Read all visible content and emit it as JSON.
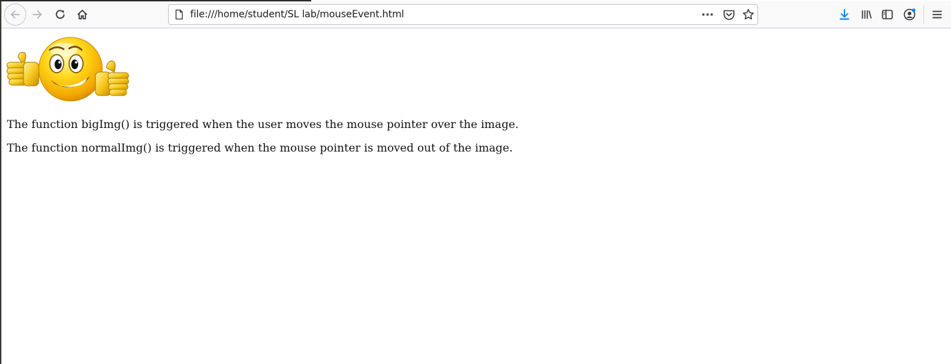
{
  "browser": {
    "url": "file:///home/student/SL lab/mouseEvent.html",
    "icons": {
      "back": "arrow-left-icon",
      "forward": "arrow-right-icon",
      "reload": "reload-icon",
      "home": "home-icon",
      "page": "page-icon",
      "more": "ellipsis-icon",
      "pocket": "pocket-icon",
      "bookmark": "star-icon",
      "downloads": "download-icon",
      "library": "library-icon",
      "sidebar": "sidebar-icon",
      "account": "account-icon",
      "menu": "hamburger-menu-icon"
    },
    "colors": {
      "download_accent": "#0a84ff",
      "toolbar_bg": "#f9f9fa"
    }
  },
  "page": {
    "image": "thumbs-up-smiley-image",
    "paragraphs": [
      "The function bigImg() is triggered when the user moves the mouse pointer over the image.",
      "The function normalImg() is triggered when the mouse pointer is moved out of the image."
    ]
  }
}
